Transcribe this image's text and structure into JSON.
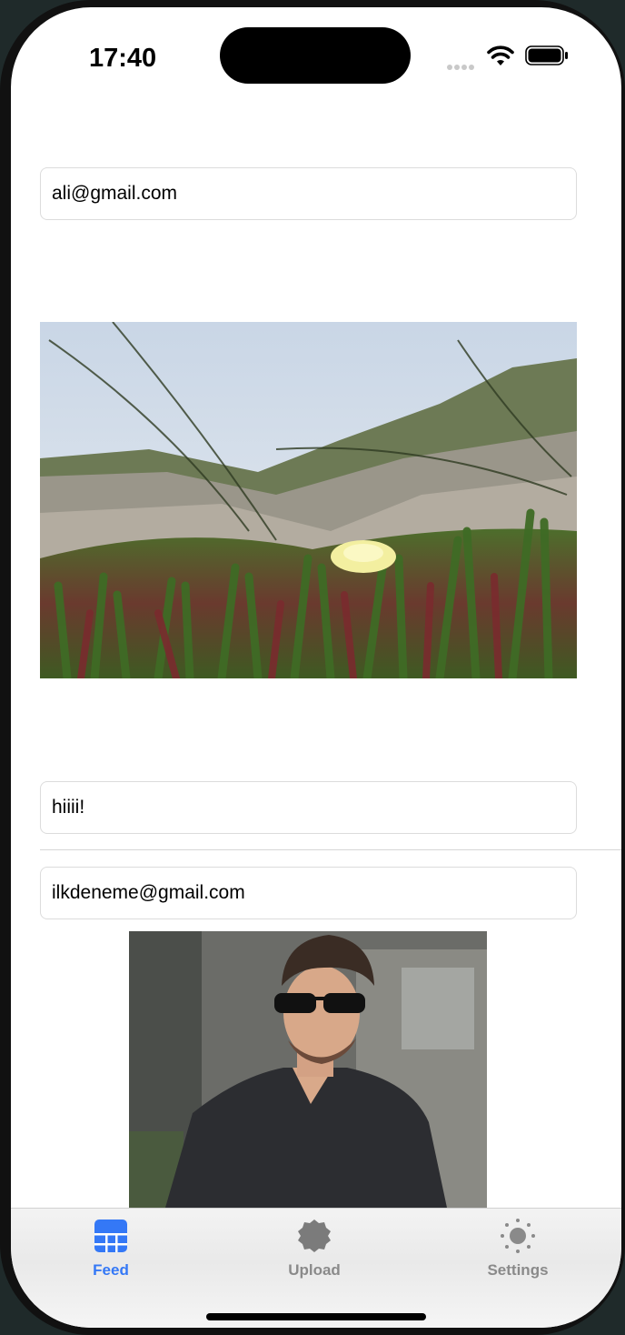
{
  "status_bar": {
    "time": "17:40"
  },
  "feed": {
    "posts": [
      {
        "email": "ali@gmail.com",
        "image": "beach-ice-plant-flower-photo",
        "comment": "hiiii!"
      },
      {
        "email": "ilkdeneme@gmail.com",
        "image": "man-sunglasses-dark-shirt-photo"
      }
    ]
  },
  "tabbar": {
    "tabs": [
      {
        "label": "Feed",
        "icon": "grid-icon",
        "active": true
      },
      {
        "label": "Upload",
        "icon": "upload-badge-icon",
        "active": false
      },
      {
        "label": "Settings",
        "icon": "sun-gear-icon",
        "active": false
      }
    ]
  },
  "colors": {
    "accent": "#3478f6",
    "inactive_tab": "#8a8a8a",
    "field_border": "#dcdcdc"
  }
}
